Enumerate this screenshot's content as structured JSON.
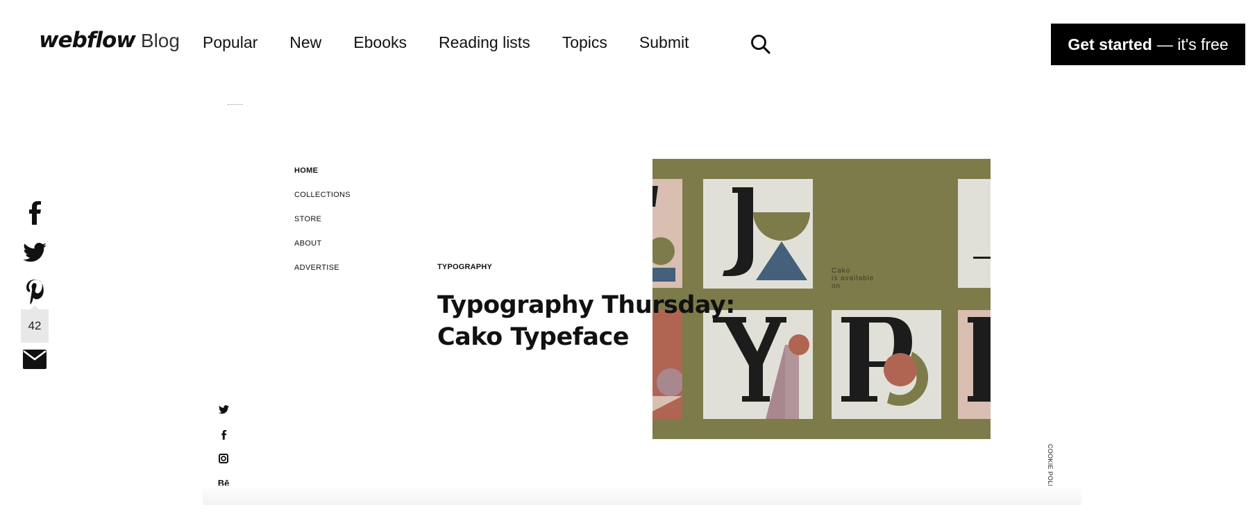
{
  "header": {
    "logo_word": "webflow",
    "logo_section": "Blog",
    "nav": [
      "Popular",
      "New",
      "Ebooks",
      "Reading lists",
      "Topics",
      "Submit"
    ],
    "search_icon": "search-icon",
    "cta_bold": "Get started",
    "cta_rest": "— it's free"
  },
  "share": {
    "icons": [
      "facebook-icon",
      "twitter-icon",
      "pinterest-icon",
      "mail-icon"
    ],
    "count": "42"
  },
  "article_preview": {
    "nav": [
      "HOME",
      "COLLECTIONS",
      "STORE",
      "ABOUT",
      "ADVERTISE"
    ],
    "category": "TYPOGRAPHY",
    "title_line1": "Typography Thursday:",
    "title_line2": "Cako Typeface",
    "artwork_caption": [
      "Cako",
      "is available",
      "on"
    ],
    "social": [
      "twitter-icon",
      "facebook-icon",
      "instagram-icon",
      "Bē"
    ],
    "cookie_policy": "COOKIE POLICY",
    "colors": {
      "olive": "#7d7b4a",
      "cream": "#e1e0d8",
      "blush": "#d9bfb2",
      "terracotta": "#b06553",
      "slate_blue": "#44607a",
      "mauve": "#a9878f",
      "ink": "#1c1c1c"
    }
  }
}
